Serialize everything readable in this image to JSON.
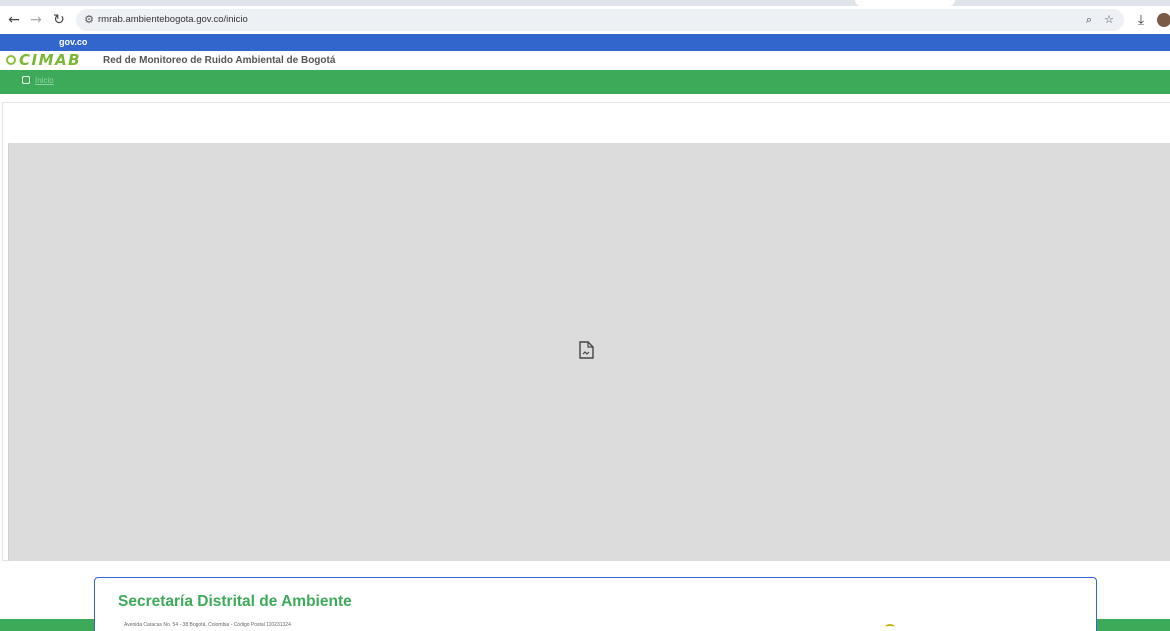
{
  "browser": {
    "url": "rmrab.ambientebogota.gov.co/inicio",
    "icons": {
      "back": "arrow-left-icon",
      "forward": "arrow-right-icon",
      "reload": "reload-icon",
      "site_info": "tune-icon",
      "zoom": "zoom-icon",
      "bookmark": "star-icon",
      "download": "download-icon",
      "profile": "avatar"
    }
  },
  "gov_bar": {
    "logo": "gov.co",
    "color": "#3366cc"
  },
  "header": {
    "logo_text": "CIMAB",
    "title": "Red de Monitoreo de Ruido Ambiental de Bogotá"
  },
  "nav": {
    "home_label": "Inicio",
    "color": "#3daa5a"
  },
  "footer": {
    "title": "Secretaría Distrital de Ambiente",
    "address": "Avenida Caracas No. 54 - 38 Bogotá, Colombia - Código Postal 110231324"
  }
}
